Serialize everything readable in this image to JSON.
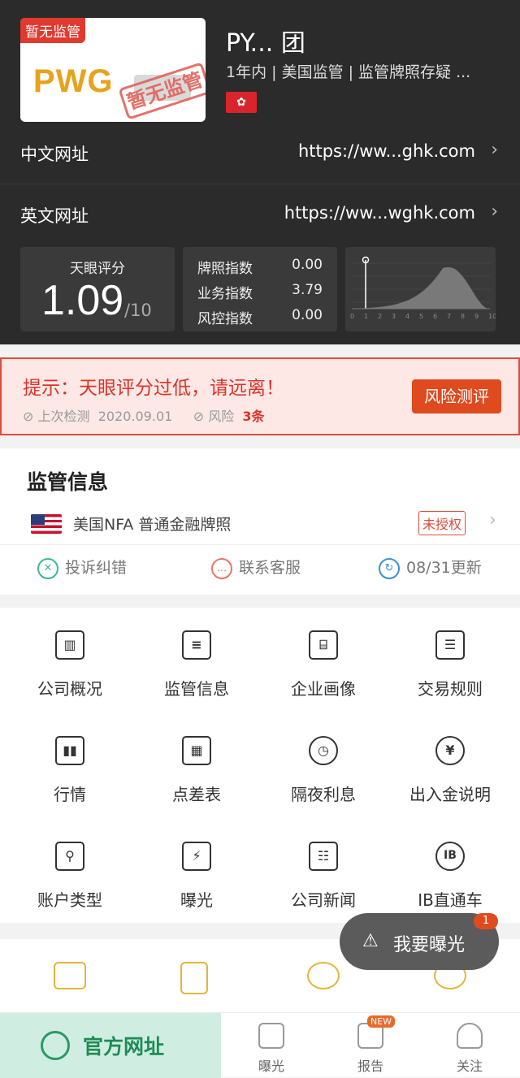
{
  "header": {
    "logo_tag": "暂无监管",
    "logo_text": "PWG",
    "logo_stamp": "暂无监管",
    "firm_name": "PY... 团",
    "firm_sub": "1年内 | 美国监管 | 监管牌照存疑 ...",
    "region_flag_icon": "flag-hong-kong-icon",
    "cn_url_label": "中文网址",
    "cn_url": "https://ww...ghk.com",
    "en_url_label": "英文网址",
    "en_url": "https://ww...wghk.com"
  },
  "score": {
    "label": "天眼评分",
    "value": "1.09",
    "denominator": "/10",
    "indices": [
      {
        "label": "牌照指数",
        "value": "0.00"
      },
      {
        "label": "业务指数",
        "value": "3.79"
      },
      {
        "label": "风控指数",
        "value": "0.00"
      }
    ],
    "curve_ticks": [
      "0",
      "1",
      "2",
      "3",
      "4",
      "5",
      "6",
      "7",
      "8",
      "9",
      "10"
    ]
  },
  "tip": {
    "title": "提示：天眼评分过低，请远离！",
    "last_check_label": "上次检测",
    "last_check_date": "2020.09.01",
    "risk_label": "风险",
    "risk_count": "3条",
    "button": "风险测评"
  },
  "regulation": {
    "title": "监管信息",
    "row_text": "美国NFA  普通金融牌照",
    "status": "未授权",
    "actions": [
      {
        "label": "投诉纠错",
        "color": "#3cb98a"
      },
      {
        "label": "联系客服",
        "color": "#e8756a"
      },
      {
        "label": "08/31更新",
        "color": "#3a8fd8"
      }
    ]
  },
  "grid": [
    {
      "label": "公司概况",
      "icon": "building-icon"
    },
    {
      "label": "监管信息",
      "icon": "document-icon"
    },
    {
      "label": "企业画像",
      "icon": "portrait-icon"
    },
    {
      "label": "交易规则",
      "icon": "list-icon"
    },
    {
      "label": "行情",
      "icon": "chart-bars-icon"
    },
    {
      "label": "点差表",
      "icon": "table-icon"
    },
    {
      "label": "隔夜利息",
      "icon": "clock-coins-icon"
    },
    {
      "label": "出入金说明",
      "icon": "yen-exchange-icon"
    },
    {
      "label": "账户类型",
      "icon": "user-list-icon"
    },
    {
      "label": "曝光",
      "icon": "alarm-light-icon"
    },
    {
      "label": "公司新闻",
      "icon": "newspaper-icon"
    },
    {
      "label": "IB直通车",
      "icon": "ib-circle-icon"
    }
  ],
  "float": {
    "label": "我要曝光",
    "badge": "1"
  },
  "tabbar": {
    "main": "官方网址",
    "tabs": [
      {
        "label": "曝光"
      },
      {
        "label": "报告",
        "badge": "NEW"
      },
      {
        "label": "关注"
      }
    ]
  }
}
